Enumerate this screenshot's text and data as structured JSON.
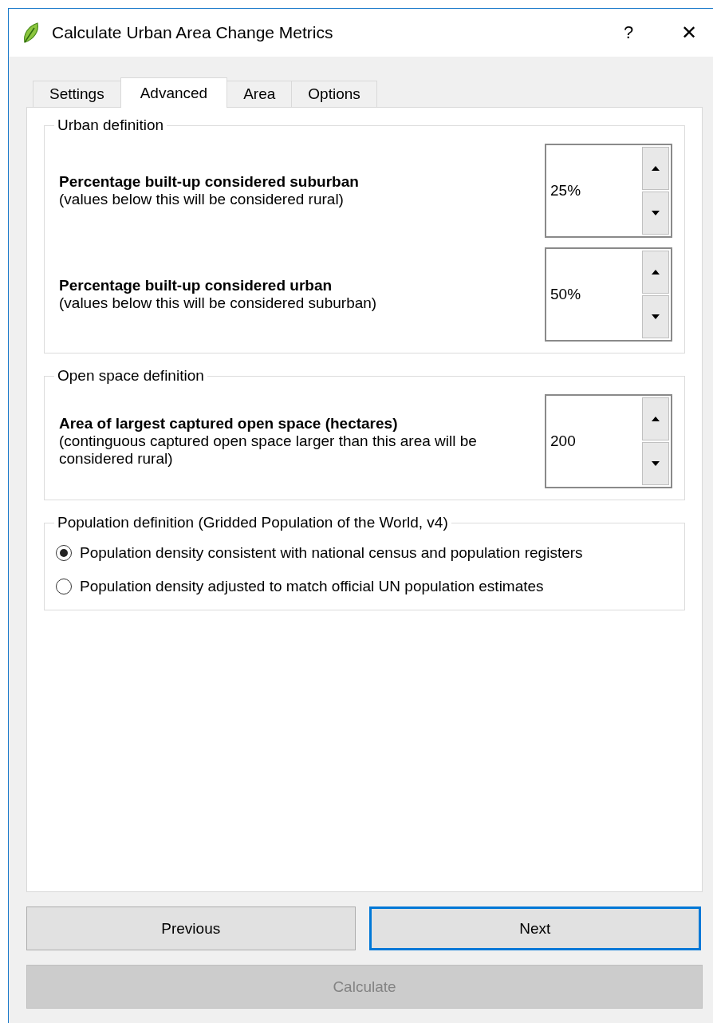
{
  "window": {
    "title": "Calculate Urban Area Change Metrics",
    "help": "?",
    "close": "✕"
  },
  "tabs": [
    {
      "label": "Settings",
      "selected": false
    },
    {
      "label": "Advanced",
      "selected": true
    },
    {
      "label": "Area",
      "selected": false
    },
    {
      "label": "Options",
      "selected": false
    }
  ],
  "groups": [
    {
      "title": "Urban definition",
      "kind": "spin",
      "fields": [
        {
          "label": "Percentage built-up considered suburban",
          "hint": "(values below this will be considered rural)",
          "value": "25%"
        },
        {
          "label": "Percentage built-up considered urban",
          "hint": "(values below this will be considered suburban)",
          "value": "50%"
        }
      ]
    },
    {
      "title": "Open space definition",
      "kind": "spin",
      "fields": [
        {
          "label": "Area of largest captured open space (hectares)",
          "hint": "(continguous captured open space larger than this area will be considered rural)",
          "value": "200"
        }
      ]
    },
    {
      "title": "Population definition (Gridded Population of the World, v4)",
      "kind": "radio",
      "options": [
        {
          "label": "Population density consistent with national census and population registers",
          "selected": true
        },
        {
          "label": "Population density adjusted to match official UN population estimates",
          "selected": false
        }
      ]
    }
  ],
  "buttons": [
    {
      "label": "Previous",
      "focused": false,
      "disabled": false
    },
    {
      "label": "Next",
      "focused": true,
      "disabled": false
    }
  ],
  "calculate": {
    "label": "Calculate",
    "disabled": true
  }
}
